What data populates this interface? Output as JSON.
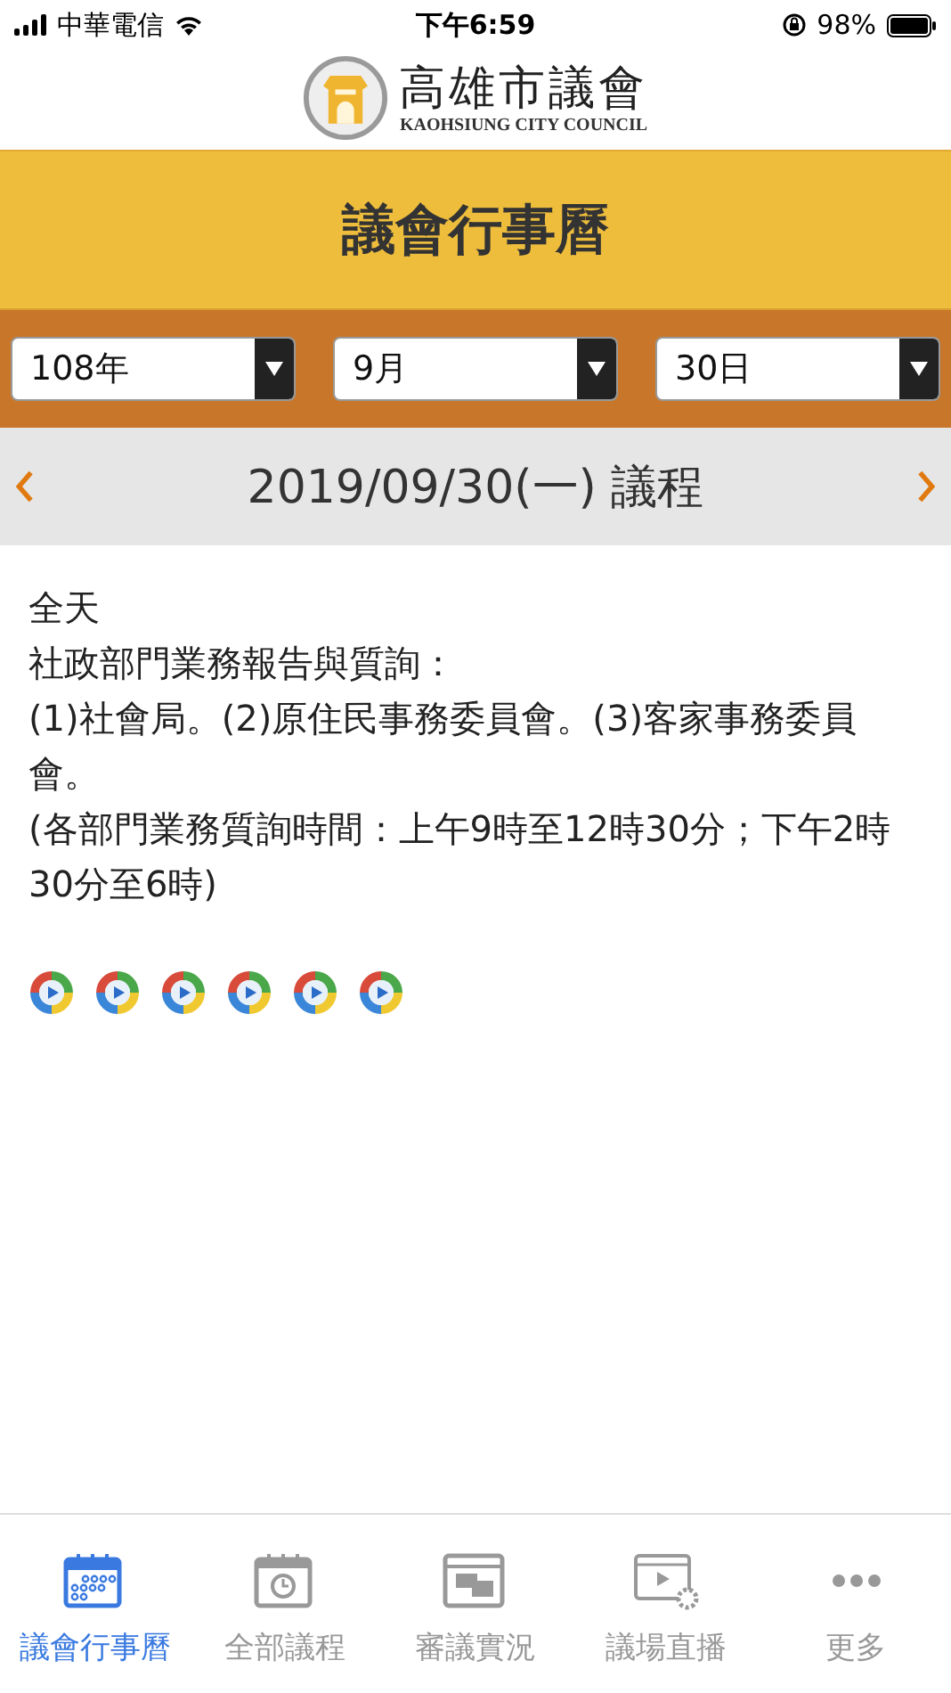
{
  "status_bar": {
    "carrier": "中華電信",
    "time": "下午6:59",
    "battery": "98%"
  },
  "logo": {
    "name": "高雄市議會",
    "subtitle": "KAOHSIUNG CITY COUNCIL"
  },
  "page_title": "議會行事曆",
  "selectors": [
    {
      "value": "108年"
    },
    {
      "value": "9月"
    },
    {
      "value": "30日"
    }
  ],
  "date_bar": {
    "title": "2019/09/30(一) 議程"
  },
  "agenda": {
    "time": "全天",
    "lines": [
      "社政部門業務報告與質詢：",
      "(1)社會局。(2)原住民事務委員會。(3)客家事務委員會。",
      "(各部門業務質詢時間：上午9時至12時30分；下午2時30分至6時)"
    ]
  },
  "videos": [
    {
      "kind": "play"
    },
    {
      "kind": "play"
    },
    {
      "kind": "play"
    },
    {
      "kind": "play"
    },
    {
      "kind": "play"
    },
    {
      "kind": "play"
    }
  ],
  "tab_bar": [
    {
      "label": "議會行事曆",
      "kind": "calendar",
      "selected": true
    },
    {
      "label": "全部議程",
      "kind": "clock-calendar",
      "selected": false
    },
    {
      "label": "審議實況",
      "kind": "chat-window",
      "selected": false
    },
    {
      "label": "議場直播",
      "kind": "video-gear",
      "selected": false
    },
    {
      "label": "更多",
      "kind": "more",
      "selected": false
    }
  ]
}
